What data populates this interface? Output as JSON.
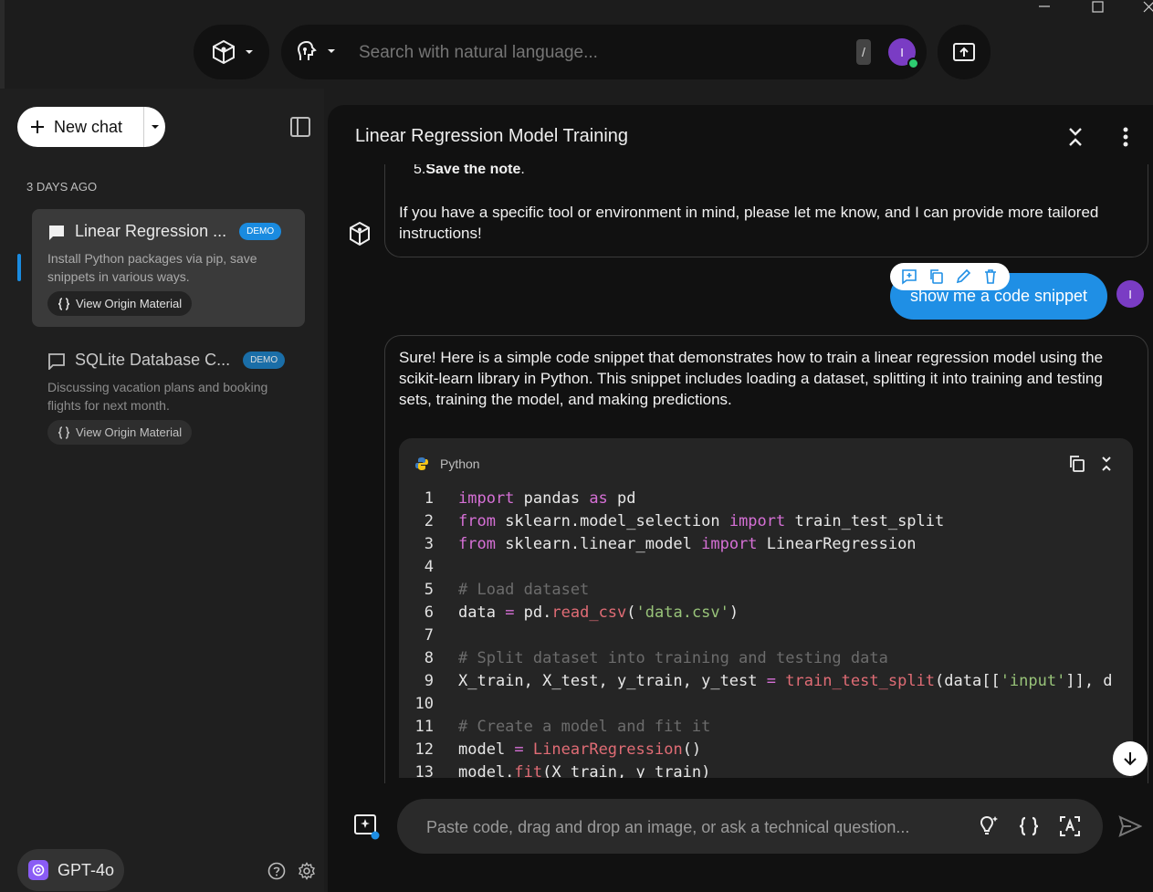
{
  "topbar": {
    "search_placeholder": "Search with natural language...",
    "slash_hint": "/",
    "user_initial": "I"
  },
  "sidebar": {
    "new_chat_label": "New chat",
    "section_label": "3 DAYS AGO",
    "chats": [
      {
        "title": "Linear Regression ...",
        "badge": "DEMO",
        "description": "Install Python packages via pip, save snippets in various ways.",
        "origin_label": "View Origin Material"
      },
      {
        "title": "SQLite Database C...",
        "badge": "DEMO",
        "description": "Discussing vacation plans and booking flights for next month.",
        "origin_label": "View Origin Material"
      }
    ],
    "model_label": "GPT-4o"
  },
  "conversation": {
    "title": "Linear Regression Model Training",
    "prev_list_item_number": "5.",
    "prev_list_item_bold": "Save the note",
    "prev_list_item_tail": ".",
    "prev_message_end": "If you have a specific tool or environment in mind, please let me know, and I can provide more tailored instructions!",
    "user_message": "show me a code snippet",
    "user_initial": "I",
    "assistant_intro": "Sure! Here is a simple code snippet that demonstrates how to train a linear regression model using the scikit-learn library in Python. This snippet includes loading a dataset, splitting it into training and testing sets, training the model, and making predictions.",
    "code_language": "Python"
  },
  "composer": {
    "placeholder": "Paste code, drag and drop an image, or ask a technical question..."
  },
  "colors": {
    "accent": "#1f8fe5",
    "avatar": "#7a3cc4",
    "keyword": "#d670d6",
    "function": "#e06c75",
    "string": "#98c379",
    "comment": "#6c6c6c"
  }
}
